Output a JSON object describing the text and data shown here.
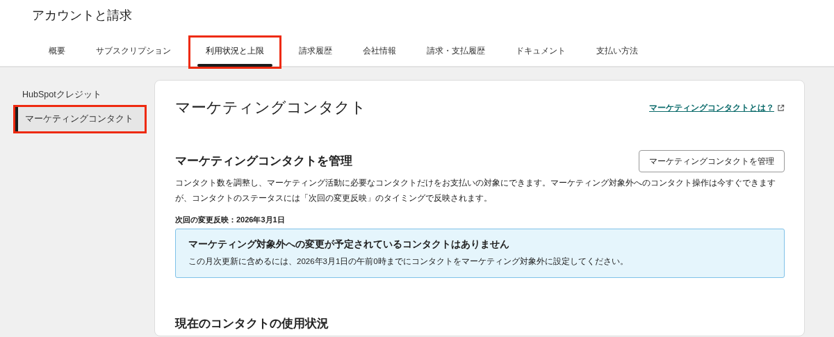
{
  "page": {
    "title": "アカウントと請求"
  },
  "tabs": [
    {
      "label": "概要",
      "selected": false,
      "highlighted": false
    },
    {
      "label": "サブスクリプション",
      "selected": false,
      "highlighted": false
    },
    {
      "label": "利用状況と上限",
      "selected": true,
      "highlighted": true
    },
    {
      "label": "請求履歴",
      "selected": false,
      "highlighted": false
    },
    {
      "label": "会社情報",
      "selected": false,
      "highlighted": false
    },
    {
      "label": "請求・支払履歴",
      "selected": false,
      "highlighted": false
    },
    {
      "label": "ドキュメント",
      "selected": false,
      "highlighted": false
    },
    {
      "label": "支払い方法",
      "selected": false,
      "highlighted": false
    }
  ],
  "sidebar": {
    "items": [
      {
        "label": "HubSpotクレジット",
        "selected": false,
        "highlighted": false
      },
      {
        "label": "マーケティングコンタクト",
        "selected": true,
        "highlighted": true
      }
    ]
  },
  "content": {
    "title": "マーケティングコンタクト",
    "help_link": "マーケティングコンタクトとは？",
    "manage_section": {
      "heading": "マーケティングコンタクトを管理",
      "button": "マーケティングコンタクトを管理",
      "description": "コンタクト数を調整し、マーケティング活動に必要なコンタクトだけをお支払いの対象にできます。マーケティング対象外へのコンタクト操作は今すぐできますが、コンタクトのステータスには「次回の変更反映」のタイミングで反映されます。",
      "next_change": "次回の変更反映：2026年3月1日",
      "alert": {
        "title": "マーケティング対象外への変更が予定されているコンタクトはありません",
        "body": "この月次更新に含めるには、2026年3月1日の午前0時までにコンタクトをマーケティング対象外に設定してください。"
      }
    },
    "usage_heading": "現在のコンタクトの使用状況"
  }
}
